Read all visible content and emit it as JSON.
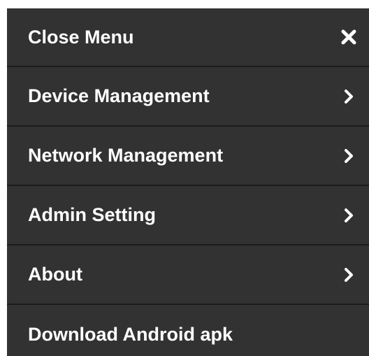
{
  "menu": {
    "items": [
      {
        "label": "Close Menu",
        "icon": "close-icon"
      },
      {
        "label": "Device Management",
        "icon": "chevron-right-icon"
      },
      {
        "label": "Network Management",
        "icon": "chevron-right-icon"
      },
      {
        "label": "Admin Setting",
        "icon": "chevron-right-icon"
      },
      {
        "label": "About",
        "icon": "chevron-right-icon"
      },
      {
        "label": "Download Android apk",
        "icon": ""
      }
    ]
  },
  "colors": {
    "background": "#323232",
    "divider": "#1c1c1c",
    "text": "#ffffff"
  }
}
